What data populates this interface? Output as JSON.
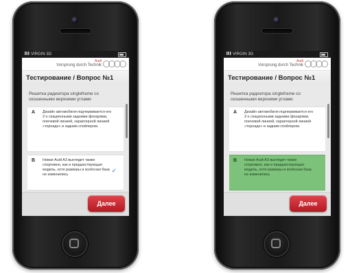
{
  "phones": [
    {
      "status": {
        "carrier": "VIRGIN",
        "network": "3G"
      },
      "brand": {
        "audi": "Audi",
        "slogan": "Vorsprung durch Technik"
      },
      "title": "Тестирование / Вопрос №1",
      "question": "Решетка радиатора singleframe со скошенными верхними углами",
      "answers": [
        {
          "letter": "A",
          "text": "Дизайн автомобиля подчеркивается его 2-х секционными задними фонарями, плечевой линией, характерной линией «торнадо» и задним спойлером."
        },
        {
          "letter": "B",
          "text": "Новая Audi A3 выглядит также спортивно, как и предшествующая модель, хотя размеры и колёсная база не изменились",
          "selected": true
        }
      ],
      "check_icon": "checkmark-icon",
      "next_label": "Далее"
    },
    {
      "status": {
        "carrier": "VIRGIN",
        "network": "3G"
      },
      "brand": {
        "audi": "Audi",
        "slogan": "Vorsprung durch Technik"
      },
      "title": "Тестирование / Вопрос №1",
      "question": "Решетка радиатора singleframe со скошенными верхними углами",
      "answers": [
        {
          "letter": "A",
          "text": "Дизайн автомобиля подчеркивается его 2-х секционными задними фонарями, плечевой линией, характерной линией «торнадо» и задним спойлером."
        },
        {
          "letter": "B",
          "text": "Новая Audi A3 выглядит также спортивно, как и предшествующая модель, хотя размеры и колёсная база не изменились",
          "correct": true,
          "highlight_color": "#7cc27a"
        }
      ],
      "next_label": "Далее"
    }
  ],
  "colors": {
    "next_button": "#c8262e",
    "correct_answer": "#7cc27a",
    "check": "#3f6fb7"
  }
}
